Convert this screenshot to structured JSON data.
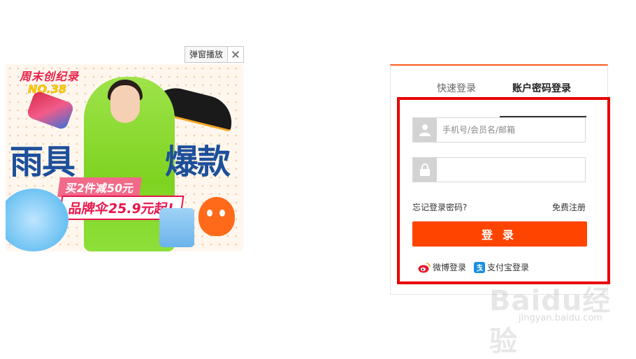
{
  "popup": {
    "play_label": "弹窗播放"
  },
  "banner": {
    "brand": "周末创纪录",
    "issue": "NO.38",
    "headline_left": "雨具",
    "headline_right": "爆款",
    "offer": "买2件减50元",
    "price": "品牌伞25.9元起!"
  },
  "login": {
    "tabs": [
      {
        "label": "快速登录",
        "active": false
      },
      {
        "label": "账户密码登录",
        "active": true
      }
    ],
    "username_placeholder": "手机号/会员名/邮箱",
    "password_placeholder": "",
    "forgot_label": "忘记登录密码?",
    "register_label": "免费注册",
    "submit_label": "登录",
    "social": [
      {
        "label": "微博登录",
        "icon": "weibo-icon"
      },
      {
        "label": "支付宝登录",
        "icon": "alipay-icon"
      }
    ],
    "accent_color": "#ff4400",
    "highlight_color": "#e80000"
  },
  "watermark": {
    "main": "Baidu经验",
    "sub": "jingyan.baidu.com"
  }
}
